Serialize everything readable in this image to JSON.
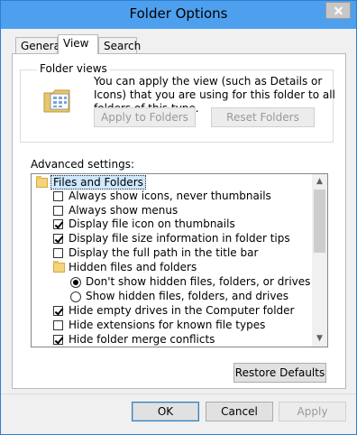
{
  "window": {
    "title": "Folder Options"
  },
  "tabs": [
    {
      "label": "General"
    },
    {
      "label": "View"
    },
    {
      "label": "Search"
    }
  ],
  "folder_views": {
    "title": "Folder views",
    "description": "You can apply the view (such as Details or Icons) that you are using for this folder to all folders of this type.",
    "apply_button": "Apply to Folders",
    "reset_button": "Reset Folders"
  },
  "advanced": {
    "label": "Advanced settings:",
    "items": [
      {
        "type": "folder",
        "label": "Files and Folders",
        "selected": true
      },
      {
        "type": "checkbox",
        "label": "Always show icons, never thumbnails",
        "checked": false
      },
      {
        "type": "checkbox",
        "label": "Always show menus",
        "checked": false
      },
      {
        "type": "checkbox",
        "label": "Display file icon on thumbnails",
        "checked": true
      },
      {
        "type": "checkbox",
        "label": "Display file size information in folder tips",
        "checked": true
      },
      {
        "type": "checkbox",
        "label": "Display the full path in the title bar",
        "checked": false
      },
      {
        "type": "folder",
        "label": "Hidden files and folders"
      },
      {
        "type": "radio",
        "label": "Don't show hidden files, folders, or drives",
        "checked": true
      },
      {
        "type": "radio",
        "label": "Show hidden files, folders, and drives",
        "checked": false
      },
      {
        "type": "checkbox",
        "label": "Hide empty drives in the Computer folder",
        "checked": true
      },
      {
        "type": "checkbox",
        "label": "Hide extensions for known file types",
        "checked": false
      },
      {
        "type": "checkbox",
        "label": "Hide folder merge conflicts",
        "checked": true
      }
    ]
  },
  "restore_defaults": "Restore Defaults",
  "footer": {
    "ok": "OK",
    "cancel": "Cancel",
    "apply": "Apply"
  }
}
